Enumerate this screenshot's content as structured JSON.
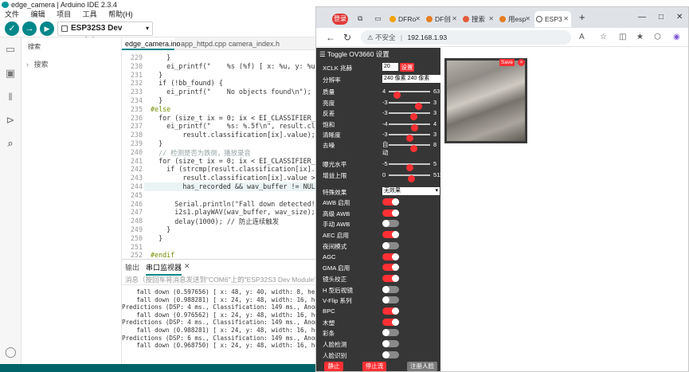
{
  "ide": {
    "title": "edge_camera | Arduino IDE 2.3.4",
    "menu": [
      "文件",
      "编辑",
      "项目",
      "工具",
      "帮助(H)"
    ],
    "board": "ESP32S3 Dev Module",
    "sidebar_title": "搜索",
    "search_placeholder": "搜索",
    "tabs": [
      "edge_camera.ino",
      "app_httpd.cpp",
      "camera_index.h"
    ],
    "code_lines": [
      {
        "n": "229",
        "t": "    }"
      },
      {
        "n": "230",
        "t": "    ei_printf(\"    %s (%f) [ x: %u, y: %u, "
      },
      {
        "n": "231",
        "t": "  }"
      },
      {
        "n": "232",
        "t": "  if (!bb_found) {"
      },
      {
        "n": "233",
        "t": "    ei_printf(\"    No objects found\\n\");"
      },
      {
        "n": "234",
        "t": "  }"
      },
      {
        "n": "235",
        "t": "#else"
      },
      {
        "n": "236",
        "t": "  for (size_t ix = 0; ix < EI_CLASSIFIER_LABE"
      },
      {
        "n": "237",
        "t": "    ei_printf(\"    %s: %.5f\\n\", result.classif"
      },
      {
        "n": "238",
        "t": "        result.classification[ix].value);"
      },
      {
        "n": "239",
        "t": "  }"
      },
      {
        "n": "240",
        "t": "  // 检测是否为跌倒，播放录音"
      },
      {
        "n": "241",
        "t": "  for (size_t ix = 0; ix < EI_CLASSIFIER_LABE"
      },
      {
        "n": "242",
        "t": "    if (strcmp(result.classification[ix].la"
      },
      {
        "n": "243",
        "t": "        result.classification[ix].value > 0"
      },
      {
        "n": "244",
        "t": "        has_recorded && wav_buffer != NULL)"
      },
      {
        "n": "245",
        "t": ""
      },
      {
        "n": "246",
        "t": "      Serial.println(\"Fall down detected!"
      },
      {
        "n": "247",
        "t": "      i2s1.playWAV(wav_buffer, wav_size);"
      },
      {
        "n": "248",
        "t": "      delay(1000); // 防止连续触发"
      },
      {
        "n": "249",
        "t": "    }"
      },
      {
        "n": "250",
        "t": "  }"
      },
      {
        "n": "251",
        "t": ""
      },
      {
        "n": "252",
        "t": "#endif"
      }
    ],
    "panel_tabs": [
      "输出",
      "串口监视器"
    ],
    "serial_placeholder": "消息（按回车将消息发送到\"COM6\"上的\"ESP32S3 Dev Module\"）",
    "serial_lines": [
      "    fall down (0.597656) [ x: 48, y: 40, width: 8, height: 8 ]",
      "    fall down (0.988281) [ x: 24, y: 48, width: 16, height: 16 ]",
      "Predictions (DSP: 4 ms., Classification: 149 ms., Anomaly: 0 ms.):",
      "    fall down (0.976562) [ x: 24, y: 48, width: 16, height: 16 ]",
      "Predictions (DSP: 4 ms., Classification: 149 ms., Anomaly: 0 ms.):",
      "    fall down (0.988281) [ x: 24, y: 48, width: 16, height: 16 ]",
      "Predictions (DSP: 6 ms., Classification: 149 ms., Anomaly: 0 ms.):",
      "    fall down (0.968750) [ x: 24, y: 48, width: 16, height: 16 ]"
    ]
  },
  "browser": {
    "login": "登录",
    "tabs": [
      "DFRo",
      "DF创",
      "搜索",
      "用esp",
      "ESP3"
    ],
    "url_warning": "不安全",
    "url": "192.168.1.93",
    "panel_title": "Toggle OV3660 设置",
    "xclk_label": "XCLK 兆赫",
    "xclk_value": "20",
    "set_button": "设置",
    "resolution_label": "分辨率",
    "resolution_value": "240 像素 240 像素",
    "sliders": [
      {
        "label": "质量",
        "min": "4",
        "max": "63",
        "pos": 0.2
      },
      {
        "label": "亮度",
        "min": "-3",
        "max": "3",
        "pos": 0.72
      },
      {
        "label": "反差",
        "min": "-3",
        "max": "3",
        "pos": 0.6
      },
      {
        "label": "饱和",
        "min": "-4",
        "max": "4",
        "pos": 0.62
      },
      {
        "label": "清晰度",
        "min": "-3",
        "max": "3",
        "pos": 0.5
      }
    ],
    "denoise_label": "去噪",
    "denoise_min": "自动",
    "denoise_max": "8",
    "denoise_pos": 0.6,
    "sliders2": [
      {
        "label": "曝光水平",
        "min": "-5",
        "max": "5",
        "pos": 0.5
      },
      {
        "label": "增益上限",
        "min": "0",
        "max": "511",
        "pos": 0.53
      }
    ],
    "effect_label": "特殊效果",
    "effect_value": "无效果",
    "toggles": [
      {
        "label": "AWB 启用",
        "on": true
      },
      {
        "label": "高级 AWB",
        "on": true
      },
      {
        "label": "手动 AWB",
        "on": false
      },
      {
        "label": "AEC 启用",
        "on": true
      },
      {
        "label": "夜间模式",
        "on": false
      },
      {
        "label": "AGC",
        "on": true
      },
      {
        "label": "GMA 启用",
        "on": true
      },
      {
        "label": "镜头校正",
        "on": true
      },
      {
        "label": "H 型后视镜",
        "on": false
      },
      {
        "label": "V-Flip 系列",
        "on": false
      },
      {
        "label": "BPC",
        "on": true
      },
      {
        "label": "木塑",
        "on": true
      },
      {
        "label": "彩条",
        "on": false
      },
      {
        "label": "人脸检测",
        "on": false
      },
      {
        "label": "人脸识别",
        "on": false
      }
    ],
    "bottom_buttons": [
      "静止",
      "停止流",
      "注册人脸"
    ],
    "save_label": "Save",
    "close_label": "×"
  }
}
